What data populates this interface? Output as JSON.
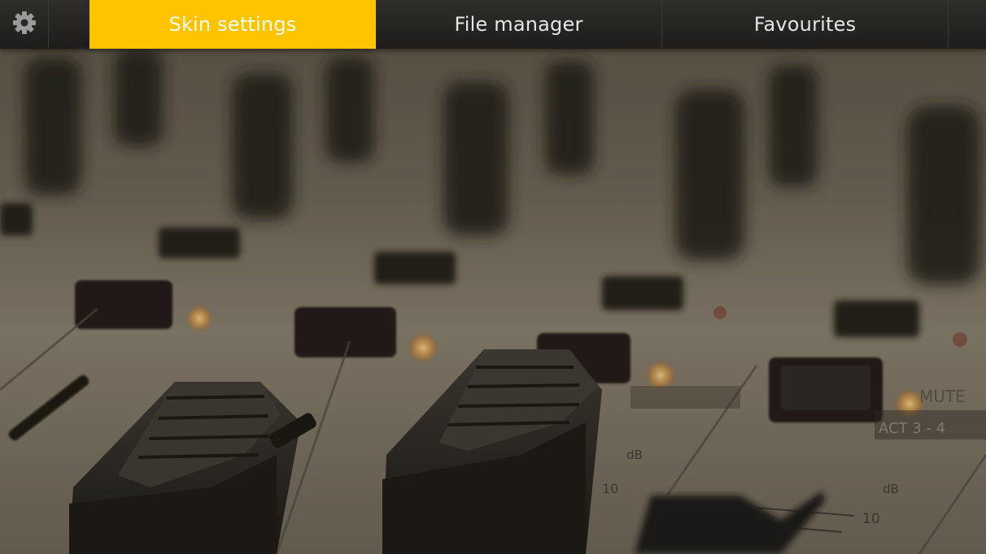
{
  "topbar": {
    "settings_icon": "gear-icon",
    "tabs": [
      {
        "label": "Skin settings",
        "active": true
      },
      {
        "label": "File manager",
        "active": false
      },
      {
        "label": "Favourites",
        "active": false
      }
    ]
  },
  "colors": {
    "accent": "#fec400",
    "bar_background": "#262522",
    "tab_text": "#e4e4e4"
  },
  "background": {
    "image": "blurred-audio-mixer-faders",
    "labels": [
      "MUTE",
      "ACT 3 - 4",
      "dB",
      "10",
      "10",
      "dB",
      "10"
    ]
  }
}
